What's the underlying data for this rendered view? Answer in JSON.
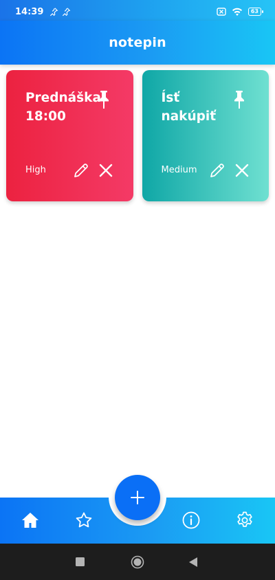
{
  "status_bar": {
    "time": "14:39",
    "battery": "63"
  },
  "app": {
    "title": "notepin"
  },
  "notes": [
    {
      "title": "Prednáška 18:00",
      "priority": "High",
      "color": "#ee2747"
    },
    {
      "title": "Ísť nakúpiť",
      "priority": "Medium",
      "color": "#19b3ad"
    }
  ],
  "bottom_nav": {
    "items": [
      "home-icon",
      "star-icon",
      "info-icon",
      "settings-icon"
    ],
    "fab": "add-icon"
  },
  "colors": {
    "accent": "#0a6ff6",
    "red": "#ee2747",
    "teal": "#19b3ad"
  }
}
